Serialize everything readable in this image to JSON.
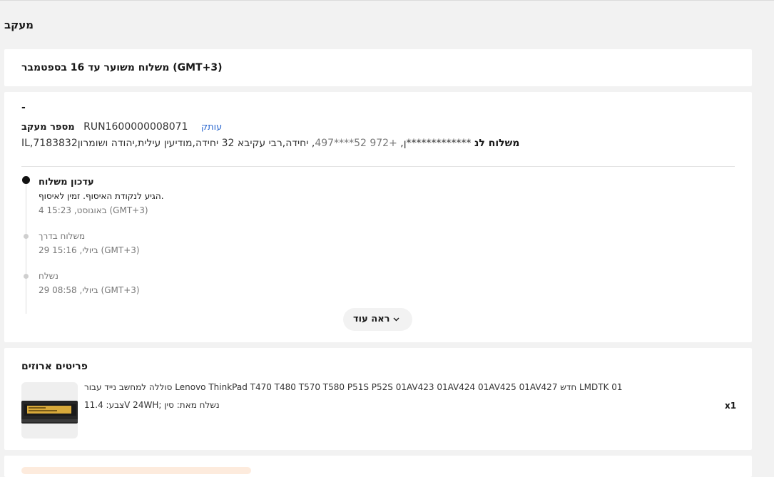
{
  "page": {
    "title": "מעקב"
  },
  "eta": {
    "text": "משלוח משוער עד 16 בספטמבר (GMT+3)"
  },
  "tracking": {
    "dash": "-",
    "number_label": "מספר מעקב",
    "number_value": "RUN1600000008071",
    "copy_label": "עותק",
    "addr_prefix": "IL,7183832",
    "ship_to_label": "משלוח לנ",
    "recipient": "*************ן",
    "phone": "+972 52****497",
    "address": "יחידה,רבי עקיבא 32 יחידה,מודיעין עילית,יהודה ושומרון"
  },
  "timeline": [
    {
      "title": "עדכון משלוח",
      "desc": "הגיע לנקודת האיסוף. זמין לאיסוף.",
      "time": "4 באוגוסט, 15:23 (GMT+3)"
    },
    {
      "title": "משלוח בדרך",
      "time": "29 ביולי, 15:16 (GMT+3)"
    },
    {
      "title": "נשלח",
      "time": "29 ביולי, 08:58 (GMT+3)"
    }
  ],
  "see_more": {
    "label": "ראה עוד",
    "icon": "chevron-down-icon"
  },
  "items": {
    "title": "פריטים ארוזים",
    "list": [
      {
        "name": "סוללה למחשב נייד עבור Lenovo ThinkPad T470 T480 T570 T580 P51S P52S 01AV423 01AV424 01AV425 01AV427 חדש LMDTK 01",
        "attrs": "צבע: 11.4V 24WH; נשלח מאת: סין",
        "qty": "x1",
        "thumb_icon": "battery-product-image"
      }
    ]
  },
  "colors": {
    "link": "#2e6ad0",
    "accent_strip": "#fdebdd",
    "background": "#f2f2f2"
  }
}
